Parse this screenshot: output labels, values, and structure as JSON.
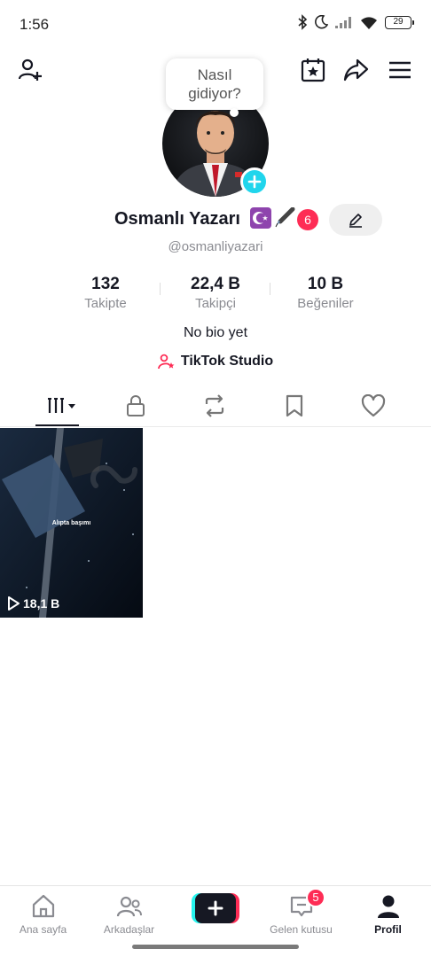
{
  "status_bar": {
    "time": "1:56",
    "battery": "29"
  },
  "header": {
    "add_friend_icon": "person-plus-icon",
    "calendar_icon": "calendar-star-icon",
    "share_icon": "share-arrow-icon",
    "menu_icon": "hamburger-menu-icon"
  },
  "profile": {
    "bubble_line1": "Nasıl",
    "bubble_line2": "gidiyor?",
    "display_name": "Osmanlı Yazarı",
    "name_emoji": "☪️✒️",
    "notification_count": "6",
    "username": "@osmanliyazari",
    "bio": "No bio yet",
    "studio_label": "TikTok Studio"
  },
  "stats": [
    {
      "value": "132",
      "label": "Takipte"
    },
    {
      "value": "22,4 B",
      "label": "Takipçi"
    },
    {
      "value": "10 B",
      "label": "Beğeniler"
    }
  ],
  "videos": [
    {
      "title": "Alıpta başımı",
      "views": "18,1 B"
    }
  ],
  "bottom_nav": {
    "home": "Ana sayfa",
    "friends": "Arkadaşlar",
    "inbox": "Gelen kutusu",
    "inbox_badge": "5",
    "profile": "Profil"
  },
  "colors": {
    "accent": "#fe2c55",
    "cyan": "#25f4ee",
    "add_badge": "#20d5ec"
  }
}
